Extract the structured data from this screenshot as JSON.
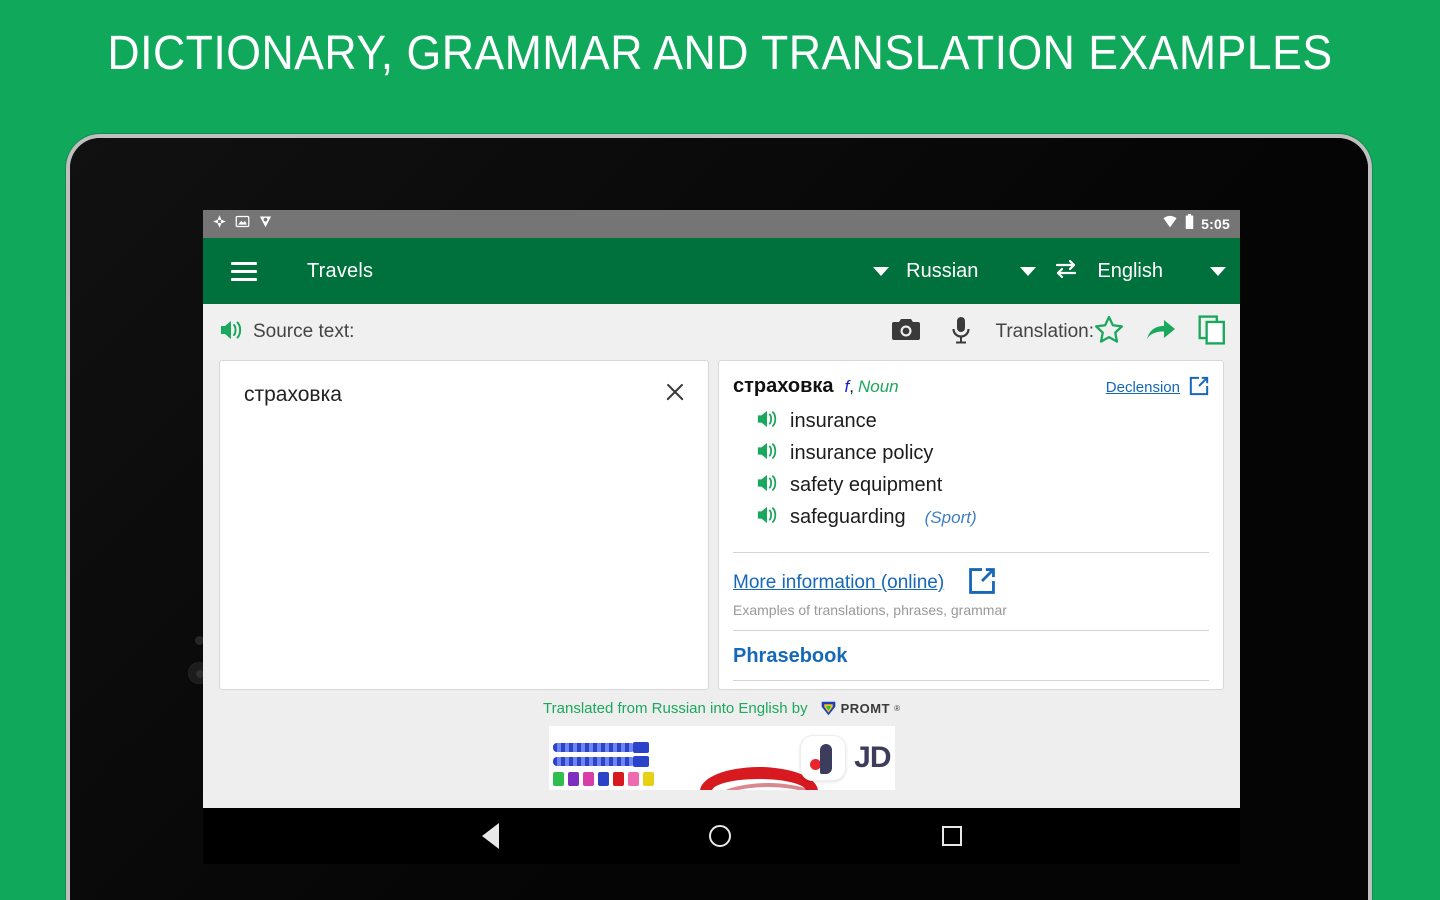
{
  "banner": {
    "title": "DICTIONARY, GRAMMAR AND TRANSLATION EXAMPLES"
  },
  "status_bar": {
    "time": "5:05",
    "left_icons": [
      "sync-icon",
      "screenshot-icon",
      "app-icon"
    ],
    "right_icons": [
      "wifi-icon",
      "battery-icon"
    ]
  },
  "app_bar": {
    "menu_label": "Menu",
    "title": "Travels",
    "source_language": "Russian",
    "target_language": "English",
    "swap_label": "Swap languages"
  },
  "action_bar": {
    "source_label": "Source text:",
    "translation_label": "Translation:",
    "icons": {
      "speaker": "speaker-icon",
      "camera": "camera-icon",
      "microphone": "microphone-icon",
      "favorite": "star-outline-icon",
      "share": "share-icon",
      "copy": "copy-icon"
    }
  },
  "source_panel": {
    "text": "страховка",
    "clear_label": "Clear"
  },
  "result_panel": {
    "headword": "страховка",
    "gender": "f",
    "comma": ",",
    "part_of_speech": "Noun",
    "declension_label": "Declension",
    "translations": [
      {
        "text": "insurance",
        "domain": ""
      },
      {
        "text": "insurance policy",
        "domain": ""
      },
      {
        "text": "safety equipment",
        "domain": ""
      },
      {
        "text": "safeguarding",
        "domain": "(Sport)"
      }
    ],
    "more_info": {
      "link": "More information (online)",
      "subtitle": "Examples of translations, phrases, grammar"
    },
    "phrasebook": "Phrasebook"
  },
  "attribution": {
    "text": "Translated from Russian into English by",
    "brand": "PROMT",
    "registered": "®"
  },
  "ad": {
    "brand": "JD",
    "plug_colors": [
      "#2fbf4f",
      "#7d2fbf",
      "#d63fa8",
      "#2b43c8",
      "#d71920",
      "#f06ab0",
      "#e8d017"
    ]
  },
  "nav_bar": {
    "back": "back-button",
    "home": "home-button",
    "recents": "recents-button"
  },
  "colors": {
    "page_background": "#10a85a",
    "app_bar": "#00713c",
    "accent_green": "#1aa85c",
    "link_blue": "#1668b8",
    "gender_blue": "#1a1ad0"
  }
}
